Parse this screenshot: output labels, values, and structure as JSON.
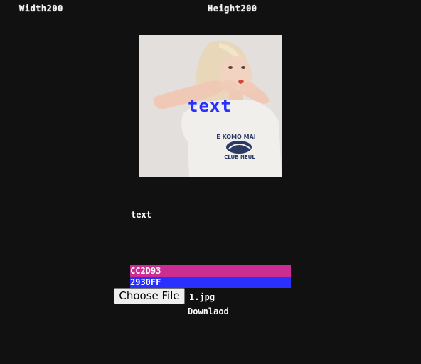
{
  "header": {
    "width_label": "Width200",
    "height_label": "Height200"
  },
  "preview": {
    "overlay_text": "text",
    "overlay_color": "#2930FF",
    "shirt_text_top": "E KOMO MAI",
    "shirt_text_bottom": "CLUB NEUL"
  },
  "caption": "text",
  "colors": {
    "background_hex": "CC2D93",
    "background_color": "#CC2D93",
    "text_hex": "2930FF",
    "text_color": "#2930FF"
  },
  "file_input": {
    "button_label": "Choose File",
    "file_name": "1.jpg"
  },
  "download_label": "Downlaod"
}
